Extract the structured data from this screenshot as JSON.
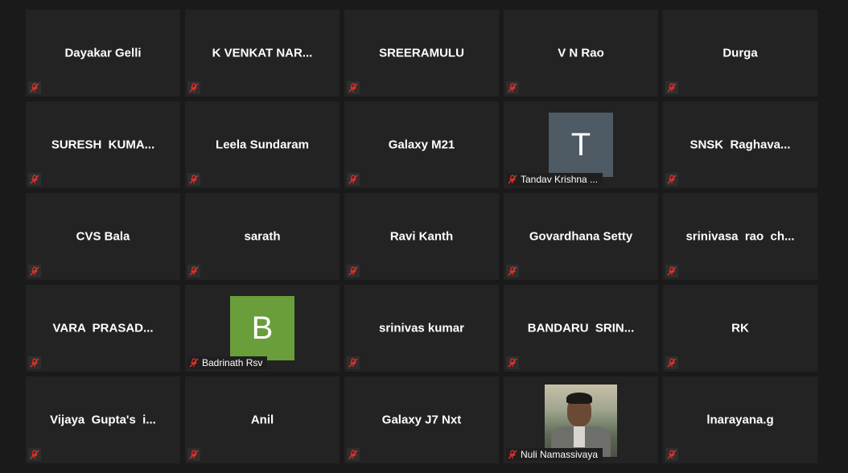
{
  "participants": [
    {
      "name": "Dayakar Gelli",
      "muted": true
    },
    {
      "name": "K VENKAT NAR...",
      "muted": true
    },
    {
      "name": "SREERAMULU",
      "muted": true
    },
    {
      "name": "V N Rao",
      "muted": true
    },
    {
      "name": "Durga",
      "muted": true
    },
    {
      "name": "SURESH  KUMA...",
      "muted": true
    },
    {
      "name": "Leela Sundaram",
      "muted": true
    },
    {
      "name": "Galaxy M21",
      "muted": true
    },
    {
      "name": "Tandav Krishna ...",
      "muted": true,
      "avatar_letter": "T",
      "avatar_color": "#4e5b64"
    },
    {
      "name": "SNSK  Raghava...",
      "muted": true
    },
    {
      "name": "CVS Bala",
      "muted": true
    },
    {
      "name": "sarath",
      "muted": true
    },
    {
      "name": "Ravi Kanth",
      "muted": true
    },
    {
      "name": "Govardhana Setty",
      "muted": true
    },
    {
      "name": "srinivasa  rao  ch...",
      "muted": true
    },
    {
      "name": "VARA  PRASAD...",
      "muted": true
    },
    {
      "name": "Badrinath Rsv",
      "muted": true,
      "avatar_letter": "B",
      "avatar_color": "#6a9e3a"
    },
    {
      "name": "srinivas kumar",
      "muted": true
    },
    {
      "name": "BANDARU  SRIN...",
      "muted": true
    },
    {
      "name": "RK",
      "muted": true
    },
    {
      "name": "Vijaya  Gupta's  i...",
      "muted": true
    },
    {
      "name": "Anil",
      "muted": true
    },
    {
      "name": "Galaxy J7 Nxt",
      "muted": true
    },
    {
      "name": "Nuli Namassivaya",
      "muted": true,
      "photo": "profile-photo"
    },
    {
      "name": "lnarayana.g",
      "muted": true
    }
  ],
  "colors": {
    "mute_icon": "#e0302a",
    "tile_bg": "#232323",
    "page_bg": "#1a1a1a"
  }
}
